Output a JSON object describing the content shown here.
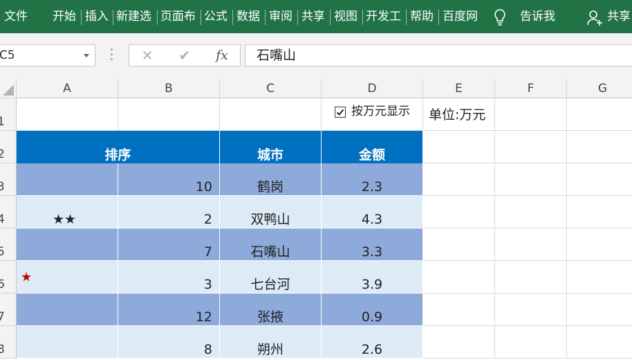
{
  "ribbon": {
    "tabs": [
      "文件",
      "开始",
      "插入",
      "新建选",
      "页面布",
      "公式",
      "数据",
      "审阅",
      "共享",
      "视图",
      "开发工",
      "帮助",
      "百度网"
    ],
    "tell_me": "告诉我",
    "share": "共享",
    "bg_color": "#217346"
  },
  "formula_bar": {
    "name_box": "C5",
    "cancel_symbol": "✕",
    "enter_symbol": "✔",
    "fx_label": "fx",
    "formula": "石嘴山"
  },
  "columns": [
    "A",
    "B",
    "C",
    "D",
    "E",
    "F",
    "G"
  ],
  "rows": [
    "1",
    "2",
    "3",
    "4",
    "5",
    "6",
    "7",
    "8"
  ],
  "checkbox": {
    "label": "按万元显示",
    "checked": true
  },
  "unit_label": "单位:万元",
  "table": {
    "headers": {
      "rank": "排序",
      "city": "城市",
      "amount": "金额"
    },
    "header_color": "#0070c0",
    "band_dark": "#8eaadb",
    "band_light": "#ddebf7",
    "rows": [
      {
        "stars": "",
        "rank": "10",
        "city": "鹤岗",
        "amount": "2.3"
      },
      {
        "stars": "★★",
        "rank": "2",
        "city": "双鸭山",
        "amount": "4.3"
      },
      {
        "stars": "",
        "rank": "7",
        "city": "石嘴山",
        "amount": "3.3"
      },
      {
        "stars": "★",
        "rank": "3",
        "city": "七台河",
        "amount": "3.9"
      },
      {
        "stars": "",
        "rank": "12",
        "city": "张掖",
        "amount": "0.9"
      },
      {
        "stars": "",
        "rank": "8",
        "city": "朔州",
        "amount": "2.6"
      }
    ]
  }
}
